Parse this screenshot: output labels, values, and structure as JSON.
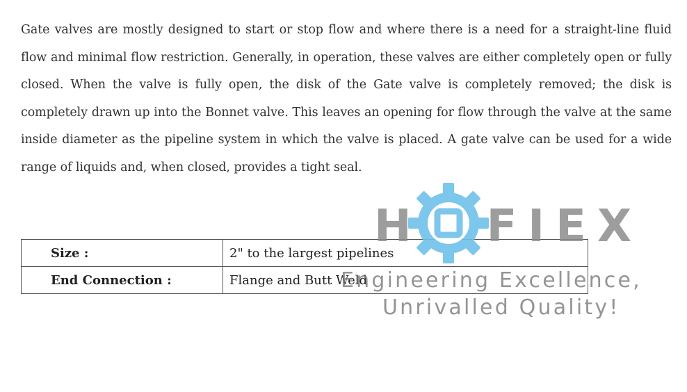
{
  "description": "Gate valves are mostly designed to start or stop flow and where there is a need for a straight-line fluid flow and minimal flow restriction. Generally, in operation, these valves are either completely open or fully closed. When the valve is fully open, the disk of the Gate valve is completely removed; the disk is completely drawn up into the Bonnet valve. This leaves an opening for flow through the valve at the same inside diameter as the pipeline system in which the valve is placed. A gate valve can be used for a wide range of liquids and, when closed, provides a tight seal.",
  "specs": [
    {
      "label": "Size :",
      "value": "2\" to the largest pipelines"
    },
    {
      "label": "End Connection :",
      "value": "Flange and Butt Weld"
    }
  ],
  "watermark": {
    "brand_left": "H",
    "brand_right": "FIEX",
    "tagline_line1": "Engineering Excellence,",
    "tagline_line2": "Unrivalled Quality!",
    "gear_icon": "gear-icon",
    "gear_color": "#6fc0ea",
    "text_color": "#8c8c8c"
  }
}
